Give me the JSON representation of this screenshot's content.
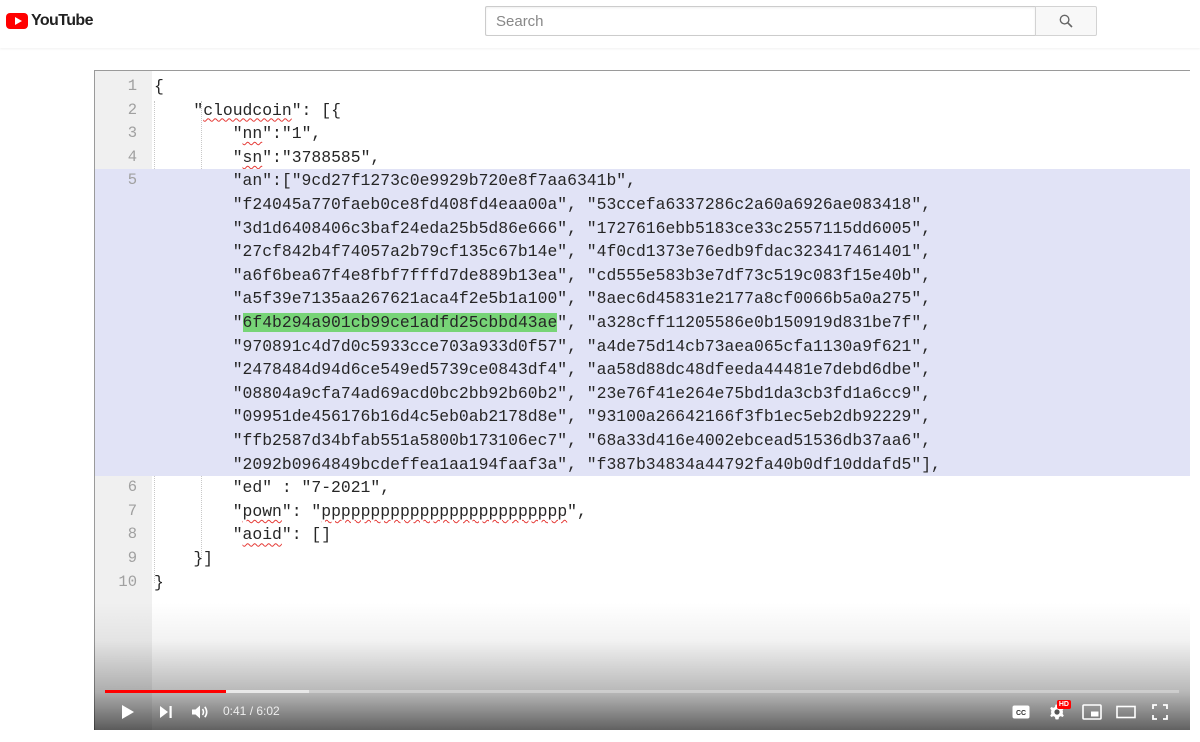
{
  "masthead": {
    "logo_text": "YouTube",
    "search_placeholder": "Search",
    "search_icon": "search-icon"
  },
  "editor": {
    "lines": [
      {
        "n": "1",
        "sel": false,
        "parts": [
          {
            "t": "{"
          }
        ]
      },
      {
        "n": "2",
        "sel": false,
        "parts": [
          {
            "t": "    \""
          },
          {
            "t": "cloudcoin",
            "u": true
          },
          {
            "t": "\": [{"
          }
        ]
      },
      {
        "n": "3",
        "sel": false,
        "parts": [
          {
            "t": "        \""
          },
          {
            "t": "nn",
            "u": true
          },
          {
            "t": "\":\"1\","
          }
        ]
      },
      {
        "n": "4",
        "sel": false,
        "parts": [
          {
            "t": "        \""
          },
          {
            "t": "sn",
            "u": true
          },
          {
            "t": "\":\"3788585\","
          }
        ]
      },
      {
        "n": "5",
        "sel": true,
        "parts": [
          {
            "t": "        \"an\":[\"9cd27f1273c0e9929b720e8f7aa6341b\","
          }
        ]
      },
      {
        "n": "",
        "sel": true,
        "parts": [
          {
            "t": "        \"f24045a770faeb0ce8fd408fd4eaa00a\", \"53ccefa6337286c2a60a6926ae083418\","
          }
        ]
      },
      {
        "n": "",
        "sel": true,
        "parts": [
          {
            "t": "        \"3d1d6408406c3baf24eda25b5d86e666\", \"1727616ebb5183ce33c2557115dd6005\","
          }
        ]
      },
      {
        "n": "",
        "sel": true,
        "parts": [
          {
            "t": "        \"27cf842b4f74057a2b79cf135c67b14e\", \"4f0cd1373e76edb9fdac323417461401\","
          }
        ]
      },
      {
        "n": "",
        "sel": true,
        "parts": [
          {
            "t": "        \"a6f6bea67f4e8fbf7fffd7de889b13ea\", \"cd555e583b3e7df73c519c083f15e40b\","
          }
        ]
      },
      {
        "n": "",
        "sel": true,
        "parts": [
          {
            "t": "        \"a5f39e7135aa267621aca4f2e5b1a100\", \"8aec6d45831e2177a8cf0066b5a0a275\","
          }
        ]
      },
      {
        "n": "",
        "sel": true,
        "parts": [
          {
            "t": "        \""
          },
          {
            "t": "6f4b294a901cb99ce1adfd25cbbd43ae",
            "h": true
          },
          {
            "t": "\", \"a328cff11205586e0b150919d831be7f\","
          }
        ]
      },
      {
        "n": "",
        "sel": true,
        "parts": [
          {
            "t": "        \"970891c4d7d0c5933cce703a933d0f57\", \"a4de75d14cb73aea065cfa1130a9f621\","
          }
        ]
      },
      {
        "n": "",
        "sel": true,
        "parts": [
          {
            "t": "        \"2478484d94d6ce549ed5739ce0843df4\", \"aa58d88dc48dfeeda44481e7debd6dbe\","
          }
        ]
      },
      {
        "n": "",
        "sel": true,
        "parts": [
          {
            "t": "        \"08804a9cfa74ad69acd0bc2bb92b60b2\", \"23e76f41e264e75bd1da3cb3fd1a6cc9\","
          }
        ]
      },
      {
        "n": "",
        "sel": true,
        "parts": [
          {
            "t": "        \"09951de456176b16d4c5eb0ab2178d8e\", \"93100a26642166f3fb1ec5eb2db92229\","
          }
        ]
      },
      {
        "n": "",
        "sel": true,
        "parts": [
          {
            "t": "        \"ffb2587d34bfab551a5800b173106ec7\", \"68a33d416e4002ebcead51536db37aa6\","
          }
        ]
      },
      {
        "n": "",
        "sel": true,
        "parts": [
          {
            "t": "        \"2092b0964849bcdeffea1aa194faaf3a\", \"f387b34834a44792fa40b0df10ddafd5\"],"
          }
        ]
      },
      {
        "n": "6",
        "sel": false,
        "parts": [
          {
            "t": "        \"ed\" : \"7-2021\","
          }
        ]
      },
      {
        "n": "7",
        "sel": false,
        "parts": [
          {
            "t": "        \""
          },
          {
            "t": "pown",
            "u": true
          },
          {
            "t": "\": \""
          },
          {
            "t": "ppppppppppppppppppppppppp",
            "u": true
          },
          {
            "t": "\","
          }
        ]
      },
      {
        "n": "8",
        "sel": false,
        "parts": [
          {
            "t": "        \""
          },
          {
            "t": "aoid",
            "u": true
          },
          {
            "t": "\": []"
          }
        ]
      },
      {
        "n": "9",
        "sel": false,
        "parts": [
          {
            "t": "    }]"
          }
        ]
      },
      {
        "n": "10",
        "sel": false,
        "parts": [
          {
            "t": "}"
          }
        ]
      }
    ]
  },
  "player": {
    "current_time": "0:41",
    "duration": "6:02",
    "time_separator": " / ",
    "played_fraction": 0.113,
    "loaded_fraction": 0.19,
    "controls": [
      "play-icon",
      "next-icon",
      "volume-icon",
      "subtitles-icon",
      "settings-icon",
      "miniplayer-icon",
      "theater-mode-icon",
      "fullscreen-icon"
    ],
    "hd_badge": "HD"
  },
  "colors": {
    "brand_red": "#ff0000",
    "progress_red": "#ff0000",
    "selection": "#e1e3f6",
    "highlight": "#77d477"
  }
}
